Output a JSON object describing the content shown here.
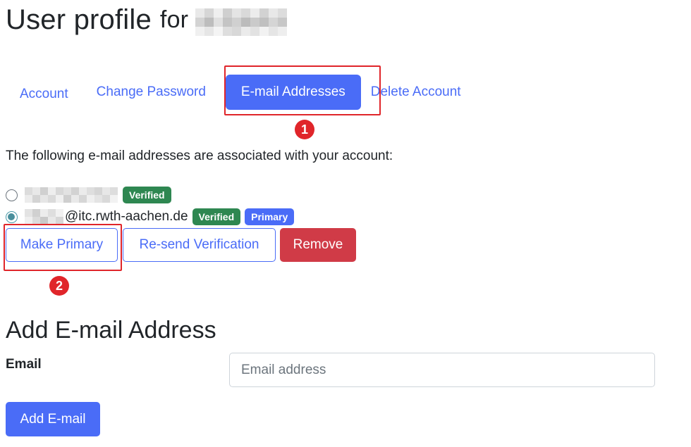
{
  "header": {
    "title": "User profile",
    "for_label": "for",
    "username_redacted": true
  },
  "tabs": [
    {
      "label": "Account",
      "active": false
    },
    {
      "label": "Change Password",
      "active": false
    },
    {
      "label": "E-mail Addresses",
      "active": true
    },
    {
      "label": "Delete Account",
      "active": false
    }
  ],
  "annotations": {
    "marker_1": "1",
    "marker_2": "2",
    "highlight_color": "#e0252a"
  },
  "emails": {
    "intro": "The following e-mail addresses are associated with your account:",
    "items": [
      {
        "address_visible": "",
        "selected": false,
        "badges": [
          "Verified"
        ]
      },
      {
        "address_visible": "@itc.rwth-aachen.de",
        "selected": true,
        "badges": [
          "Verified",
          "Primary"
        ]
      }
    ],
    "actions": {
      "make_primary": "Make Primary",
      "resend_verification": "Re-send Verification",
      "remove": "Remove"
    }
  },
  "add_email": {
    "title": "Add E-mail Address",
    "field_label": "Email",
    "placeholder": "Email address",
    "value": "",
    "submit_label": "Add E-mail"
  },
  "colors": {
    "accent": "#4a6cf7",
    "success": "#2e8751",
    "danger": "#d03b47",
    "text": "#212529"
  }
}
